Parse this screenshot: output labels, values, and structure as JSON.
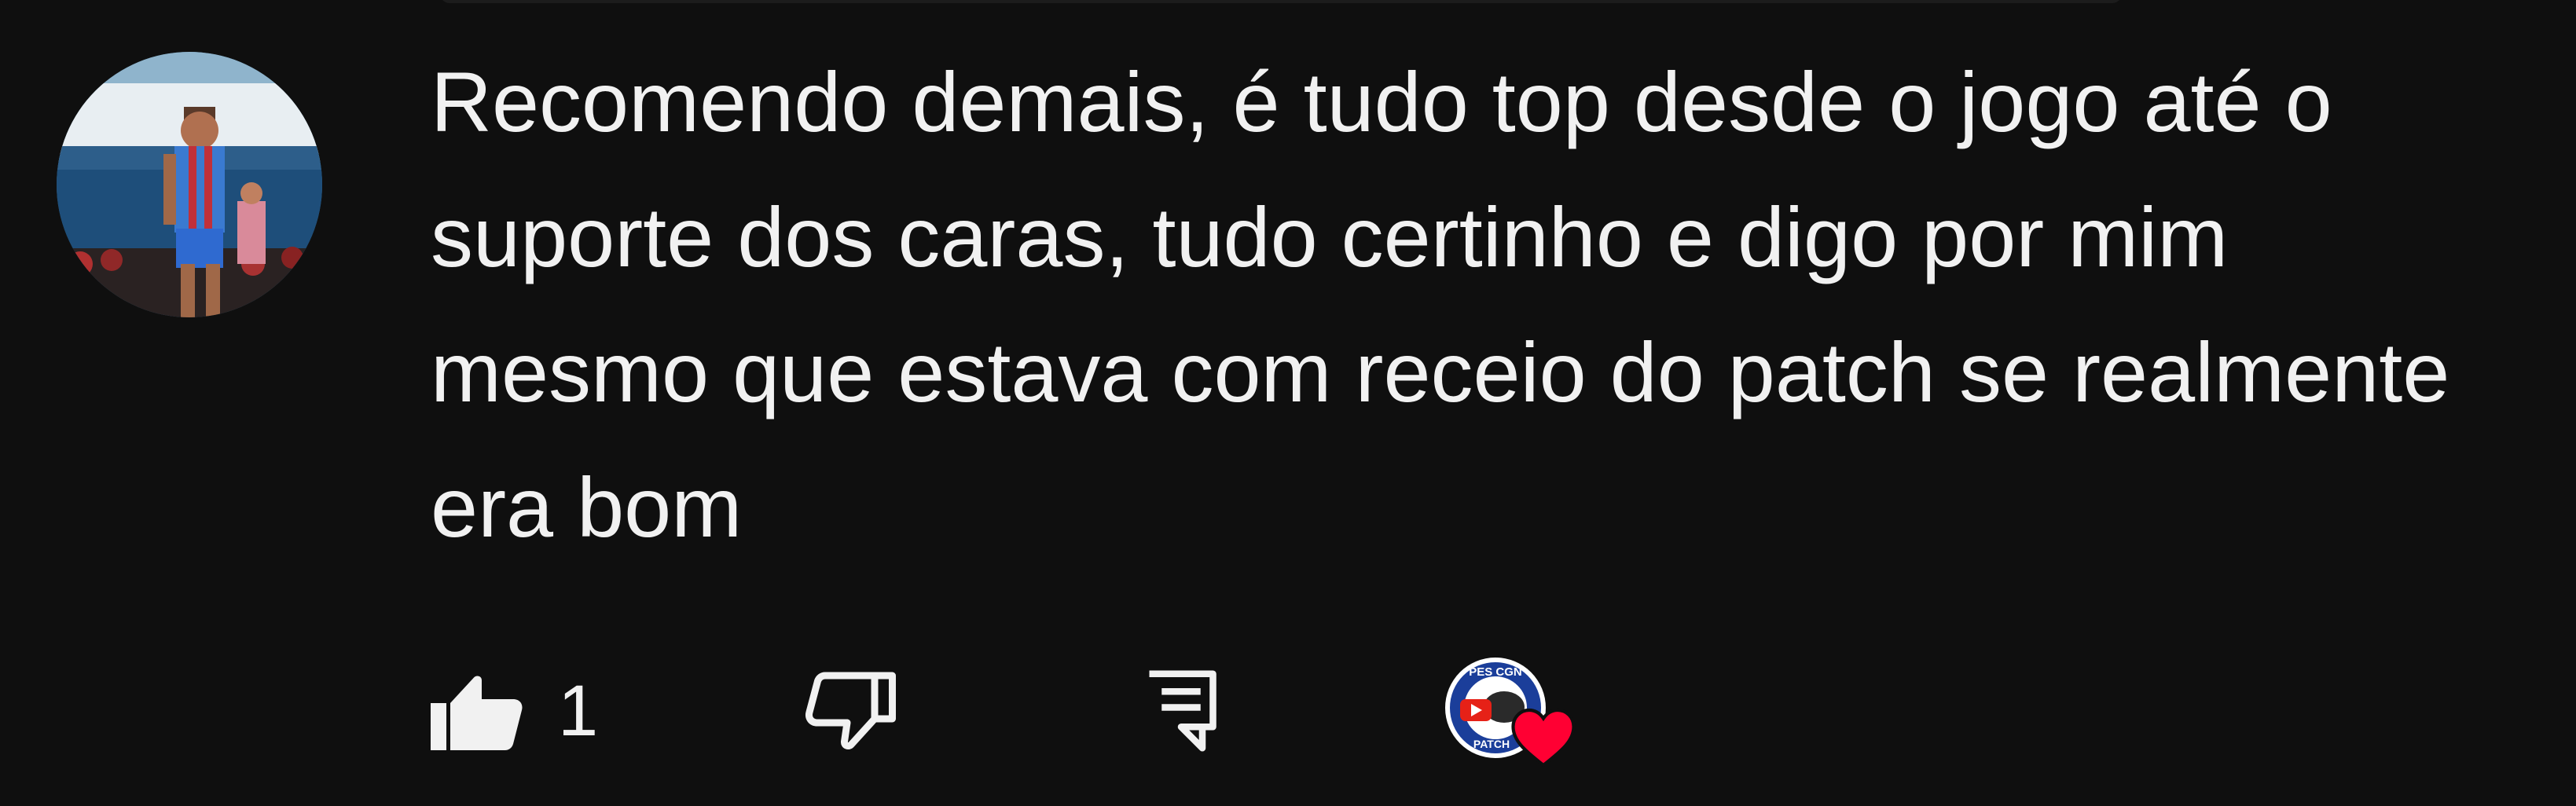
{
  "comment": {
    "text": "Recomendo demais, é tudo top desde o jogo até o suporte dos caras, tudo certinho e digo por mim mesmo que estava com receio do patch se realmente era bom"
  },
  "actions": {
    "like_count": "1"
  },
  "creator": {
    "logo_text_top": "PES CGN",
    "logo_text_bottom": "PATCH"
  },
  "icons": {
    "like": "thumbs-up-icon",
    "dislike": "thumbs-down-icon",
    "reply": "comment-reply-icon",
    "heart": "heart-icon"
  },
  "colors": {
    "background": "#0f0f0f",
    "text": "#f1f1f1",
    "heart": "#ff0033"
  }
}
